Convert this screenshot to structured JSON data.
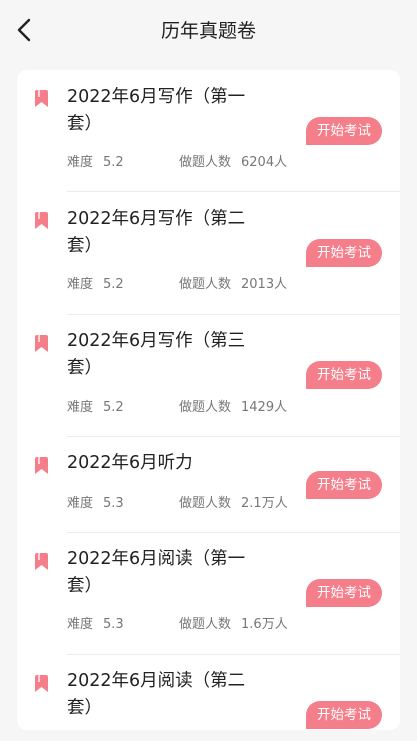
{
  "header": {
    "title": "历年真题卷"
  },
  "labels": {
    "difficulty": "难度",
    "participants": "做题人数",
    "start": "开始考试"
  },
  "exams": [
    {
      "title": "2022年6月写作（第一套）",
      "difficulty": "5.2",
      "count": "6204人"
    },
    {
      "title": "2022年6月写作（第二套）",
      "difficulty": "5.2",
      "count": "2013人"
    },
    {
      "title": "2022年6月写作（第三套）",
      "difficulty": "5.2",
      "count": "1429人"
    },
    {
      "title": "2022年6月听力",
      "difficulty": "5.3",
      "count": "2.1万人"
    },
    {
      "title": "2022年6月阅读（第一套）",
      "difficulty": "5.3",
      "count": "1.6万人"
    },
    {
      "title": "2022年6月阅读（第二套）",
      "difficulty": "",
      "count": ""
    }
  ],
  "colors": {
    "accent": "#f47e8a",
    "icon": "#f47e8a"
  }
}
